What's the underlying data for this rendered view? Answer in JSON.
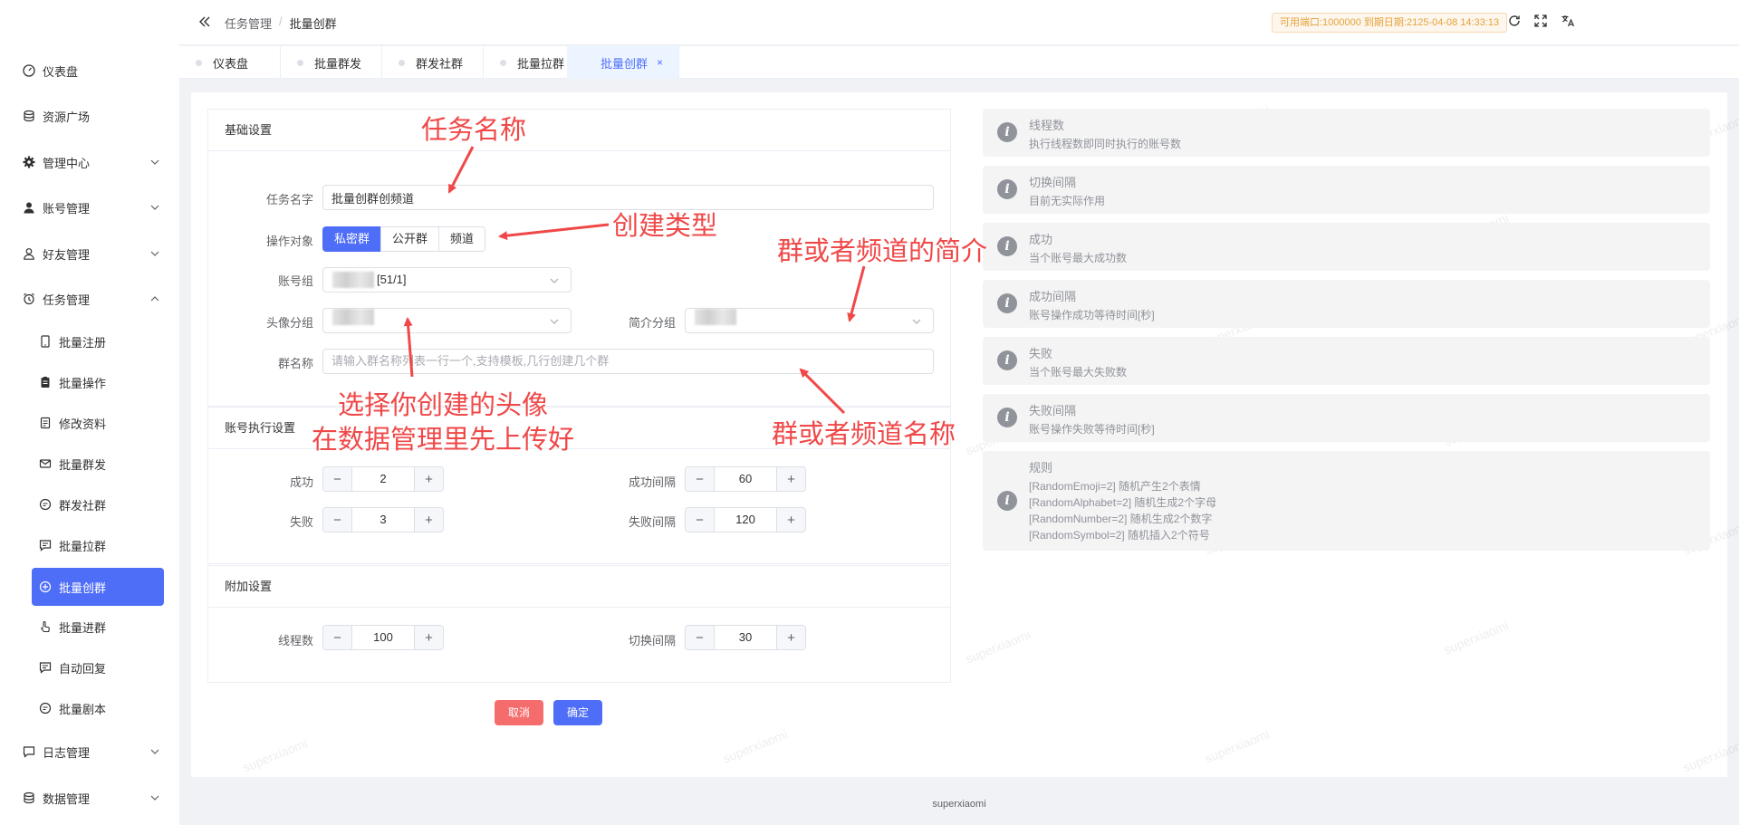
{
  "sidebar": {
    "items": [
      {
        "label": "仪表盘",
        "icon": "dashboard-icon"
      },
      {
        "label": "资源广场",
        "icon": "database-icon"
      },
      {
        "label": "管理中心",
        "icon": "gear-icon"
      },
      {
        "label": "账号管理",
        "icon": "user-icon"
      },
      {
        "label": "好友管理",
        "icon": "user-outline-icon"
      },
      {
        "label": "任务管理",
        "icon": "alarm-clock-icon"
      }
    ],
    "sub_items": [
      {
        "label": "批量注册"
      },
      {
        "label": "批量操作"
      },
      {
        "label": "修改资料"
      },
      {
        "label": "批量群发"
      },
      {
        "label": "群发社群"
      },
      {
        "label": "批量拉群"
      },
      {
        "label": "批量创群"
      },
      {
        "label": "批量进群"
      },
      {
        "label": "自动回复"
      },
      {
        "label": "批量剧本"
      }
    ],
    "bottom_items": [
      {
        "label": "日志管理"
      },
      {
        "label": "数据管理"
      }
    ]
  },
  "header": {
    "breadcrumb": [
      "任务管理",
      "/",
      "批量创群"
    ],
    "expire_text": "可用端口:1000000 到期日期:2125-04-08 14:33:13"
  },
  "tabs": [
    {
      "label": "仪表盘"
    },
    {
      "label": "批量群发"
    },
    {
      "label": "群发社群"
    },
    {
      "label": "批量拉群"
    },
    {
      "label": "批量创群",
      "close": "×"
    }
  ],
  "basic": {
    "title": "基础设置",
    "task_name_label": "任务名字",
    "task_name_value": "批量创群创频道",
    "target_label": "操作对象",
    "target_options": [
      "私密群",
      "公开群",
      "频道"
    ],
    "account_group_label": "账号组",
    "account_group_value": "[51/1]",
    "avatar_group_label": "头像分组",
    "intro_group_label": "简介分组",
    "group_name_label": "群名称",
    "group_name_placeholder": "请输入群名称列表一行一个,支持模板,几行创建几个群"
  },
  "account_exec": {
    "title": "账号执行设置",
    "success_label": "成功",
    "success_value": "2",
    "success_interval_label": "成功间隔",
    "success_interval_value": "60",
    "fail_label": "失败",
    "fail_value": "3",
    "fail_interval_label": "失败间隔",
    "fail_interval_value": "120"
  },
  "extra": {
    "title": "附加设置",
    "threads_label": "线程数",
    "threads_value": "100",
    "switch_interval_label": "切换间隔",
    "switch_interval_value": "30"
  },
  "actions": {
    "cancel": "取消",
    "confirm": "确定"
  },
  "info": [
    {
      "title": "线程数",
      "desc": [
        "执行线程数即同时执行的账号数"
      ]
    },
    {
      "title": "切换间隔",
      "desc": [
        "目前无实际作用"
      ]
    },
    {
      "title": "成功",
      "desc": [
        "当个账号最大成功数"
      ]
    },
    {
      "title": "成功间隔",
      "desc": [
        "账号操作成功等待时间[秒]"
      ]
    },
    {
      "title": "失败",
      "desc": [
        "当个账号最大失败数"
      ]
    },
    {
      "title": "失败间隔",
      "desc": [
        "账号操作失败等待时间[秒]"
      ]
    },
    {
      "title": "规则",
      "desc": [
        "[RandomEmoji=2] 随机产生2个表情",
        "[RandomAlphabet=2] 随机生成2个字母",
        "[RandomNumber=2] 随机生成2个数字",
        "[RandomSymbol=2] 随机插入2个符号"
      ]
    }
  ],
  "annotations": {
    "task_name": "任务名称",
    "create_type": "创建类型",
    "intro": "群或者频道的简介",
    "avatar_line1": "选择你创建的头像",
    "avatar_line2": "在数据管理里先上传好",
    "group_name": "群或者频道名称"
  },
  "watermark": "superxiaomi",
  "footer": "superxiaomi",
  "colors": {
    "primary": "#4f6ef7",
    "danger": "#f56c6c",
    "annotation": "#f04848",
    "warning": "#e6a23c"
  }
}
